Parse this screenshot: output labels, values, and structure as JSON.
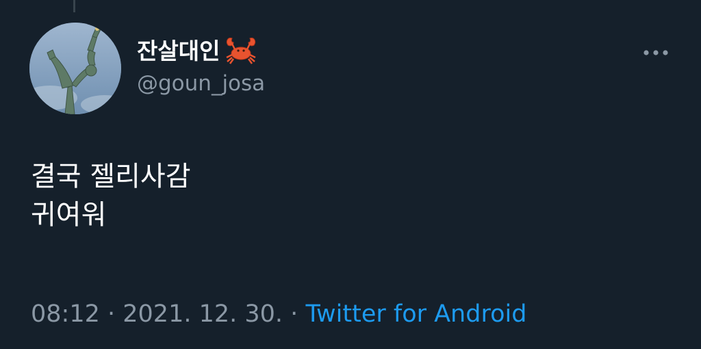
{
  "author": {
    "display_name": "잔살대인",
    "name_emoji": "crab-emoji",
    "handle": "@goun_josa",
    "avatar": "avatar-statue-of-liberty-image"
  },
  "tweet": {
    "lines": [
      "결국 젤리사감",
      "귀여워"
    ]
  },
  "meta": {
    "time": "08:12",
    "separator": " · ",
    "date": "2021. 12. 30.",
    "source": "Twitter for Android"
  },
  "icons": {
    "more": "more-horizontal-icon"
  },
  "colors": {
    "background": "#15202b",
    "text_primary": "#ffffff",
    "text_secondary": "#8b98a5",
    "link": "#1d9bf0"
  }
}
